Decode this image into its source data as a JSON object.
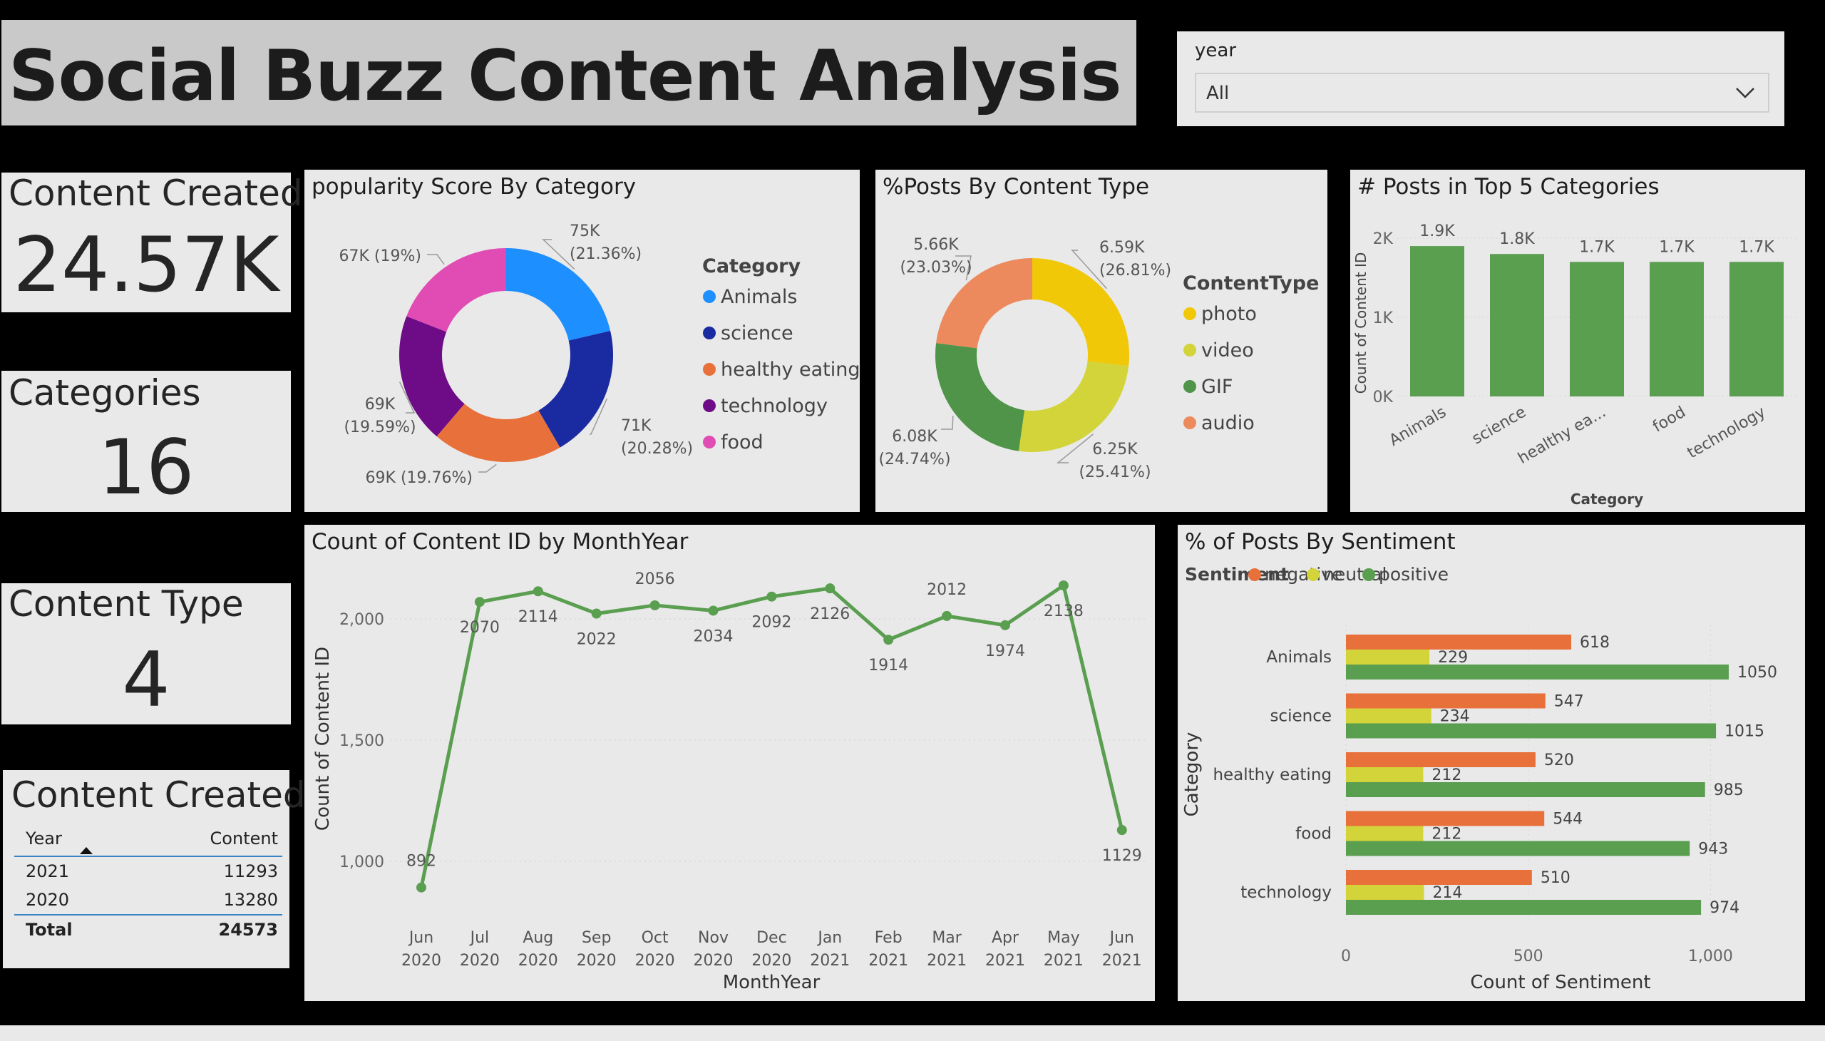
{
  "page_title": "Social Buzz Content Analysis",
  "slicer": {
    "label": "year",
    "value": "All"
  },
  "cards": [
    {
      "title": "Content Created",
      "value": "24.57K"
    },
    {
      "title": "Categories",
      "value": "16"
    },
    {
      "title": "Content Type",
      "value": "4"
    }
  ],
  "table": {
    "title": "Content Created",
    "headers": [
      "Year",
      "Content"
    ],
    "rows": [
      [
        "2021",
        "11293"
      ],
      [
        "2020",
        "13280"
      ]
    ],
    "total": [
      "Total",
      "24573"
    ]
  },
  "colors": {
    "green": "#5a9e50",
    "orange": "#e8703a",
    "yellow_green": "#d3d43a",
    "blue": "#1e8fff",
    "navy": "#1a2aa0",
    "purple": "#6d0c86",
    "pink": "#e14bb4",
    "photo": "#f0c808",
    "video": "#d3d43a",
    "gif": "#4f9448",
    "audio": "#ec8a5d"
  },
  "chart_data": [
    {
      "id": "popularity_donut",
      "type": "pie",
      "title": "popularity Score By Category",
      "legend_title": "Category",
      "legend_position": "right",
      "categories": [
        "Animals",
        "science",
        "healthy eating",
        "technology",
        "food"
      ],
      "values": [
        75,
        71,
        69,
        69,
        67
      ],
      "percents": [
        21.36,
        20.28,
        19.76,
        19.59,
        19.0
      ],
      "labels": [
        "75K",
        "71K",
        "69K",
        "69K",
        "67K"
      ],
      "label_pcts": [
        "(21.36%)",
        "(20.28%)",
        "(19.76%)",
        "(19.59%)",
        "(19%)"
      ]
    },
    {
      "id": "content_type_donut",
      "type": "pie",
      "title": "%Posts By Content Type",
      "legend_title": "ContentType",
      "legend_position": "right",
      "categories": [
        "photo",
        "video",
        "GIF",
        "audio"
      ],
      "values": [
        6.59,
        6.25,
        6.08,
        5.66
      ],
      "percents": [
        26.81,
        25.41,
        24.74,
        23.03
      ],
      "labels": [
        "6.59K",
        "6.25K",
        "6.08K",
        "5.66K"
      ],
      "label_pcts": [
        "(26.81%)",
        "(25.41%)",
        "(24.74%)",
        "(23.03%)"
      ]
    },
    {
      "id": "top5_bar",
      "type": "bar",
      "title": "# Posts in Top 5 Categories",
      "categories": [
        "Animals",
        "science",
        "healthy ea...",
        "food",
        "technology"
      ],
      "values": [
        1.9,
        1.8,
        1.7,
        1.7,
        1.7
      ],
      "data_labels": [
        "1.9K",
        "1.8K",
        "1.7K",
        "1.7K",
        "1.7K"
      ],
      "yticks": [
        "0K",
        "1K",
        "2K"
      ],
      "ylim": [
        0,
        2
      ],
      "xlabel": "Category",
      "ylabel": "Count of Content ID"
    },
    {
      "id": "monthyear_line",
      "type": "line",
      "title": "Count of Content ID by MonthYear",
      "x": [
        "Jun 2020",
        "Jul 2020",
        "Aug 2020",
        "Sep 2020",
        "Oct 2020",
        "Nov 2020",
        "Dec 2020",
        "Jan 2021",
        "Feb 2021",
        "Mar 2021",
        "Apr 2021",
        "May 2021",
        "Jun 2021"
      ],
      "x_month": [
        "Jun",
        "Jul",
        "Aug",
        "Sep",
        "Oct",
        "Nov",
        "Dec",
        "Jan",
        "Feb",
        "Mar",
        "Apr",
        "May",
        "Jun"
      ],
      "x_year": [
        "2020",
        "2020",
        "2020",
        "2020",
        "2020",
        "2020",
        "2020",
        "2021",
        "2021",
        "2021",
        "2021",
        "2021",
        "2021"
      ],
      "values": [
        892,
        2070,
        2114,
        2022,
        2056,
        2034,
        2092,
        2126,
        1914,
        2012,
        1974,
        2138,
        1129
      ],
      "yticks": [
        "1,000",
        "1,500",
        "2,000"
      ],
      "ytick_values": [
        1000,
        1500,
        2000
      ],
      "ylim": [
        850,
        2150
      ],
      "xlabel": "MonthYear",
      "ylabel": "Count of Content ID"
    },
    {
      "id": "sentiment_bar",
      "type": "bar",
      "orientation": "horizontal",
      "title": "% of Posts By Sentiment",
      "legend_title": "Sentiment",
      "legend_position": "top-left",
      "categories": [
        "Animals",
        "science",
        "healthy eating",
        "food",
        "technology"
      ],
      "series": [
        {
          "name": "negative",
          "values": [
            618,
            547,
            520,
            544,
            510
          ]
        },
        {
          "name": "neutral",
          "values": [
            229,
            234,
            212,
            212,
            214
          ]
        },
        {
          "name": "positive",
          "values": [
            1050,
            1015,
            985,
            943,
            974
          ]
        }
      ],
      "xticks": [
        "0",
        "500",
        "1,000"
      ],
      "xtick_values": [
        0,
        500,
        1000
      ],
      "xlim": [
        0,
        1100
      ],
      "xlabel": "Count of Sentiment",
      "ylabel": "Category"
    }
  ]
}
